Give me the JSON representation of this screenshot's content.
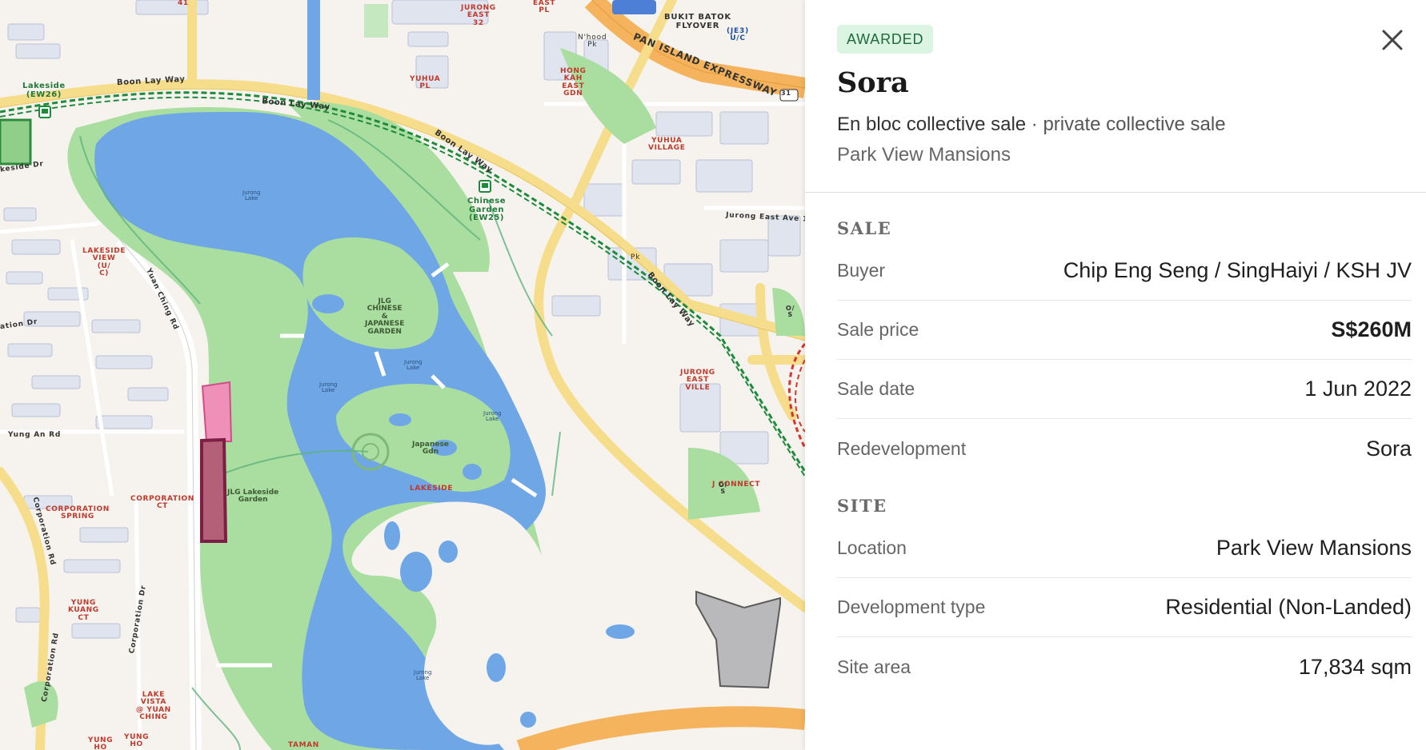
{
  "map": {
    "labels": {
      "lakeside": "Lakeside\n(EW26)",
      "chinese_garden": "Chinese\nGarden\n(EW25)",
      "boon_lay_way_1": "Boon Lay Way",
      "boon_lay_way_2": "Boon Lay Way",
      "boon_lay_way_3": "Boon Lay Way",
      "boon_lay_way_4": "Boon Lay Way",
      "pie": "PAN ISLAND EXPRESSWAY",
      "pie_num": "31",
      "bukit_batok_flyover": "BUKIT BATOK\nFLYOVER",
      "je3": "(JE3)\nU/C",
      "jurong_east_32": "JURONG\nEAST\n32",
      "east_pl": "EAST\nPL",
      "nhood_pk": "N'hood\nPk",
      "hong_kah": "HONG\nKAH\nEAST\nGDN",
      "yuhua_pl": "YUHUA\nPL",
      "yuhua_village": "YUHUA\nVILLAGE",
      "jurong_east_ave1": "Jurong East Ave 1",
      "pk": "Pk",
      "jurong_east_ville": "JURONG\nEAST\nVILLE",
      "j_connect": "J CONNECT",
      "os1": "O/\nS",
      "os2": "O/\nS",
      "jlg_chinese": "JLG\nCHINESE\n&\nJAPANESE\nGARDEN",
      "japanese_gdn": "Japanese\nGdn",
      "jlg_lakeside": "JLG Lakeside\nGarden",
      "lakeside_red": "LAKESIDE",
      "lakeside_view": "LAKESIDE\nVIEW\n(U/\nC)",
      "yuan_ching_rd": "Yuan Ching Rd",
      "yung_an_rd": "Yung An Rd",
      "corporation_rd1": "Corporation Rd",
      "corporation_rd2": "Corporation Rd",
      "corporation_dr": "Corporation Dr",
      "corporation_ct": "CORPORATION\nCT",
      "corporation_spring": "CORPORATION\nSPRING",
      "yung_kuang": "YUNG\nKUANG\nCT",
      "lake_vista": "LAKE\nVISTA\n@ YUAN\nCHING",
      "yung_ho": "YUNG\nHO",
      "yung_ho2": "YUNG\nHO",
      "taman": "TAMAN",
      "jurong_lake_1": "Jurong\nLake",
      "jurong_lake_2": "Jurong\nLake",
      "jurong_lake_3": "Jurong\nLake",
      "jurong_lake_4": "Jurong\nLake",
      "jurong_lake_5": "Jurong\nLake",
      "keside_dr": "keside Dr",
      "ation_dr": "ation Dr",
      "num_41": "41"
    }
  },
  "panel": {
    "badge": "AWARDED",
    "title": "Sora",
    "subtitle_strong": "En bloc collective sale",
    "subtitle_rest": " · private collective sale",
    "subline": "Park View Mansions",
    "sale_section": "SALE",
    "sale_rows": [
      {
        "label": "Buyer",
        "value": "Chip Eng Seng / SingHaiyi / KSH JV"
      },
      {
        "label": "Sale price",
        "value": "S$260M"
      },
      {
        "label": "Sale date",
        "value": "1 Jun 2022"
      },
      {
        "label": "Redevelopment",
        "value": "Sora"
      }
    ],
    "site_section": "SITE",
    "site_rows": [
      {
        "label": "Location",
        "value": "Park View Mansions"
      },
      {
        "label": "Development type",
        "value": "Residential (Non-Landed)"
      },
      {
        "label": "Site area",
        "value": "17,834 sqm"
      }
    ]
  },
  "colors": {
    "water": "#6ea6e6",
    "park": "#a9dea0",
    "road": "#f6dd8b",
    "expressway": "#f4b35c",
    "badge_bg": "#dcf4e2",
    "badge_text": "#1d6b3a",
    "highlight_pink": "#ee90b8",
    "highlight_maroon": "#b36078"
  },
  "icons": {
    "close": "close-icon",
    "mrt": "mrt-station-icon"
  }
}
